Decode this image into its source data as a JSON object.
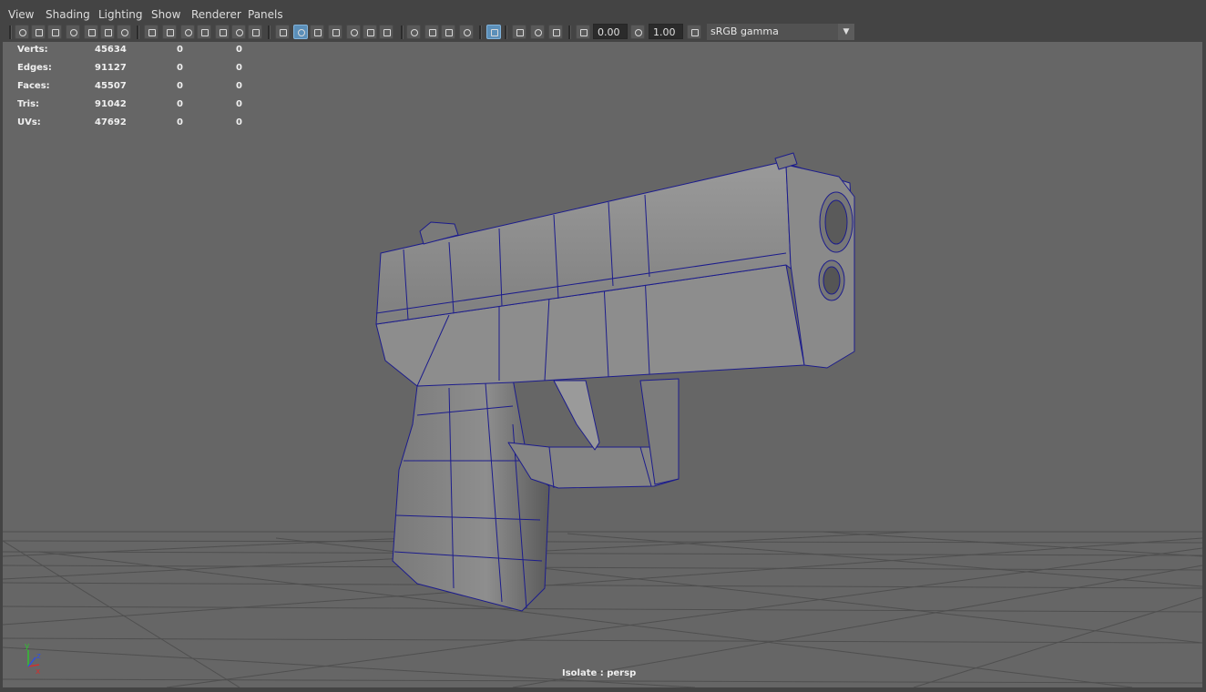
{
  "menu": {
    "items": [
      "View",
      "Shading",
      "Lighting",
      "Show",
      "Renderer",
      "Panels"
    ]
  },
  "toolbar": {
    "icons": [
      "camera-icon",
      "camera-attributes-icon",
      "camera-lock-icon",
      "bookmark-icon",
      "image-plane-icon",
      "grease-pencil-icon",
      "two-d-pan-icon",
      "grid-icon",
      "film-gate-icon",
      "resolution-gate-icon",
      "gate-mask-icon",
      "field-chart-icon",
      "safe-action-icon",
      "safe-title-icon",
      "wireframe-icon",
      "smooth-shade-icon",
      "wireframe-on-shaded-icon",
      "default-material-icon",
      "textured-icon",
      "use-all-lights-icon",
      "shadows-icon",
      "screen-space-ao-icon",
      "motion-blur-icon",
      "anti-aliasing-icon",
      "depth-of-field-icon",
      "isolate-select-icon",
      "xray-icon",
      "xray-active-components-icon",
      "xray-joints-icon",
      "exposure-icon",
      "gamma-icon",
      "color-management-icon"
    ],
    "exposure_value": "0.00",
    "gamma_value": "1.00",
    "color_space": "sRGB gamma"
  },
  "hud": {
    "stats": [
      {
        "label": "Verts:",
        "total": "45634",
        "selected": "0",
        "uv": "0"
      },
      {
        "label": "Edges:",
        "total": "91127",
        "selected": "0",
        "uv": "0"
      },
      {
        "label": "Faces:",
        "total": "45507",
        "selected": "0",
        "uv": "0"
      },
      {
        "label": "Tris:",
        "total": "91042",
        "selected": "0",
        "uv": "0"
      },
      {
        "label": "UVs:",
        "total": "47692",
        "selected": "0",
        "uv": "0"
      }
    ]
  },
  "viewport": {
    "camera_label": "Isolate : persp",
    "axis_labels": {
      "x": "x",
      "y": "y",
      "z": "z"
    },
    "colors": {
      "background": "#666666",
      "grid": "#4f4f4f",
      "mesh_fill": "#8a8a8a",
      "wireframe": "#1c1c8c",
      "axis_x": "#d03030",
      "axis_y": "#30c030",
      "axis_z": "#3050e0"
    }
  }
}
